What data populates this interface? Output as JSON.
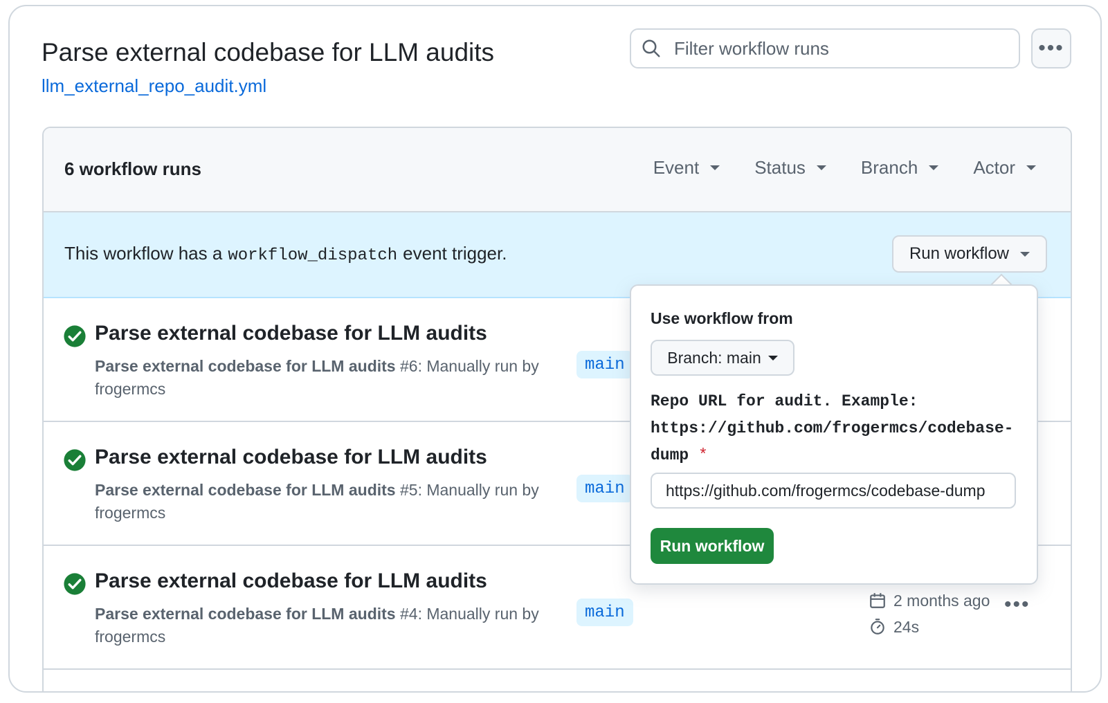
{
  "header": {
    "title": "Parse external codebase for LLM audits",
    "file": "llm_external_repo_audit.yml",
    "search_placeholder": "Filter workflow runs"
  },
  "panel": {
    "runs_count": "6 workflow runs",
    "filters": [
      "Event",
      "Status",
      "Branch",
      "Actor"
    ],
    "dispatch": {
      "text_before": "This workflow has a",
      "code": "workflow_dispatch",
      "text_after": "event trigger.",
      "button_label": "Run workflow"
    }
  },
  "runs": [
    {
      "title": "Parse external codebase for LLM audits",
      "workflow_name": "Parse external codebase for LLM audits",
      "run_number": "#6",
      "description": "Manually run by frogermcs",
      "branch": "main"
    },
    {
      "title": "Parse external codebase for LLM audits",
      "workflow_name": "Parse external codebase for LLM audits",
      "run_number": "#5",
      "description": "Manually run by frogermcs",
      "branch": "main"
    },
    {
      "title": "Parse external codebase for LLM audits",
      "workflow_name": "Parse external codebase for LLM audits",
      "run_number": "#4",
      "description": "Manually run by frogermcs",
      "branch": "main",
      "time_ago": "2 months ago",
      "duration": "24s"
    }
  ],
  "popover": {
    "heading": "Use workflow from",
    "branch_select": "Branch: main",
    "input_label": "Repo URL for audit. Example: https://github.com/frogermcs/codebase-dump",
    "required_mark": "*",
    "input_value": "https://github.com/frogermcs/codebase-dump",
    "submit_label": "Run workflow"
  },
  "colors": {
    "accent_blue": "#0969da",
    "success_green": "#1a7f37",
    "button_green": "#1f883d",
    "dispatch_bg": "#ddf4ff",
    "required_red": "#cf222e"
  }
}
